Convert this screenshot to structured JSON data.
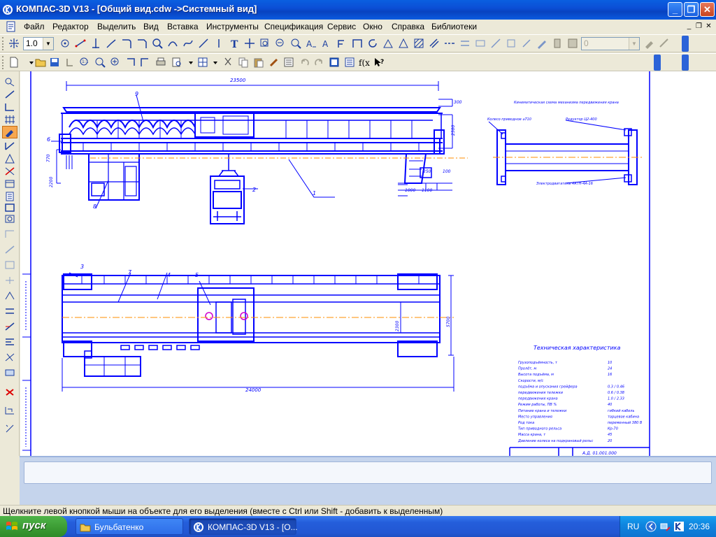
{
  "window": {
    "title": "КОМПАС-3D V13 - [Общий вид.cdw ->Системный вид]",
    "buttons": {
      "minimize": "_",
      "maximize": "❐",
      "close": "✕"
    }
  },
  "menu": {
    "items": [
      "Файл",
      "Редактор",
      "Выделить",
      "Вид",
      "Вставка",
      "Инструменты",
      "Спецификация",
      "Сервис",
      "Окно",
      "Справка",
      "Библиотеки"
    ],
    "mdi_buttons": [
      "_",
      "❐",
      "✕"
    ]
  },
  "toolbar_top": {
    "scale_value": "1.0",
    "layer_value": "0"
  },
  "drawing": {
    "texts": {
      "dim_top": "23500",
      "dim_300": "300",
      "dim_2500": "2500",
      "dim_250": "250",
      "dim_100": "100",
      "dim_1000": "1000",
      "dim_1100": "1100",
      "dim_2300": "2300",
      "dim_770": "770",
      "dim_2200": "2200",
      "dim_5700": "5700",
      "dim_bottom": "24000",
      "leader_1": "1",
      "leader_2": "2",
      "leader_3": "3",
      "leader_4": "4",
      "leader_5": "5",
      "leader_6": "6",
      "leader_7": "7",
      "leader_8": "8",
      "leader_9": "9",
      "scheme_title": "Кинематическая схема механизма передвижения крана",
      "scheme_label_1": "Колесо приводное ⌀710",
      "scheme_label_2": "Редуктор Ц2-400",
      "scheme_label_3": "Электродвигатель 4АТН-4А-16",
      "tech_title": "Техническая характеристика",
      "stamp": "А.Д. 01.001.000"
    },
    "tech_rows": [
      {
        "label": "Грузоподъёмность, т",
        "value": "10"
      },
      {
        "label": "Пролёт, м",
        "value": "24"
      },
      {
        "label": "Высота подъёма, м",
        "value": "16"
      },
      {
        "label": "Скорости, м/с",
        "value": ""
      },
      {
        "label": "подъёма и опускания грейфера",
        "value": "0.3 / 0.46"
      },
      {
        "label": "передвижения тележки",
        "value": "0.6 / 0.38"
      },
      {
        "label": "передвижения крана",
        "value": "1.0 / 2.33"
      },
      {
        "label": "Режим работы, ПВ %",
        "value": "40"
      },
      {
        "label": "Питание крана и тележки",
        "value": "гибкий кабель"
      },
      {
        "label": "Место управления",
        "value": "торцевое кабина"
      },
      {
        "label": "Род тока",
        "value": "переменный 380 В"
      },
      {
        "label": "Тип приводного рельса",
        "value": "Кр-70"
      },
      {
        "label": "Масса крана, т",
        "value": "45"
      },
      {
        "label": "Давление колеса на подкрановый рельс",
        "value": "20"
      }
    ]
  },
  "statusbar": {
    "message": "Щелкните левой кнопкой мыши на объекте для его выделения (вместе с Ctrl или Shift - добавить к выделенным)"
  },
  "taskbar": {
    "start_label": "пуск",
    "items": [
      {
        "label": "Бульбатенко",
        "active": false
      },
      {
        "label": "КОМПАС-3D V13 - [О...",
        "active": true
      }
    ],
    "language": "RU",
    "clock": "20:36"
  },
  "colors": {
    "drawing_blue": "#0000ff",
    "axis_orange": "#ff8c00",
    "xp_blue": "#245edb",
    "start_green": "#3a9a32"
  }
}
